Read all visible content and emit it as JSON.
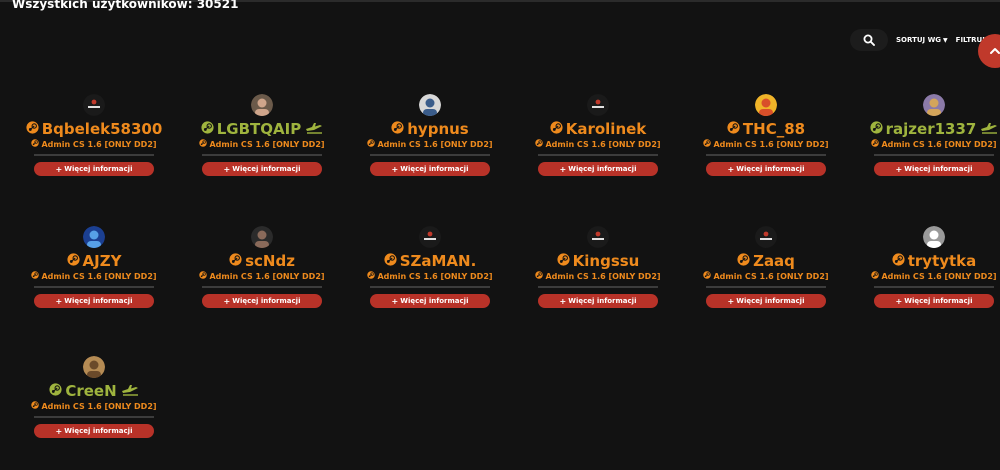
{
  "page": {
    "title": "Wszystkich użytkowników: 30521"
  },
  "toolbar": {
    "sort_label": "SORTUJ WG",
    "filter_label": "FILTRUJ"
  },
  "icons": {
    "search": "search-icon",
    "steam": "steam-icon",
    "plane": "airplane-icon",
    "plus": "plus-icon",
    "scroll_top": "chevron-up-icon"
  },
  "colors": {
    "accent": "#b83228",
    "name_orange": "#ee8a1d",
    "name_green": "#9fb43e",
    "background": "#121212"
  },
  "users": [
    {
      "name": "Bqbelek58300",
      "role": "Admin CS 1.6 [ONLY DD2]",
      "button": "Więcej informacji",
      "name_color": "orange",
      "badge": false,
      "avatar": "logo"
    },
    {
      "name": "LGBTQAIP",
      "role": "Admin CS 1.6 [ONLY DD2]",
      "button": "Więcej informacji",
      "name_color": "green",
      "badge": true,
      "avatar": "photo"
    },
    {
      "name": "hypnus",
      "role": "Admin CS 1.6 [ONLY DD2]",
      "button": "Więcej informacji",
      "name_color": "orange",
      "badge": false,
      "avatar": "photo"
    },
    {
      "name": "Karolinek",
      "role": "Admin CS 1.6 [ONLY DD2]",
      "button": "Więcej informacji",
      "name_color": "orange",
      "badge": false,
      "avatar": "logo"
    },
    {
      "name": "THC_88",
      "role": "Admin CS 1.6 [ONLY DD2]",
      "button": "Więcej informacji",
      "name_color": "orange",
      "badge": false,
      "avatar": "photo"
    },
    {
      "name": "rajzer1337",
      "role": "Admin CS 1.6 [ONLY DD2]",
      "button": "Więcej informacji",
      "name_color": "green",
      "badge": true,
      "avatar": "photo"
    },
    {
      "name": "AJZY",
      "role": "Admin CS 1.6 [ONLY DD2]",
      "button": "Więcej informacji",
      "name_color": "orange",
      "badge": false,
      "avatar": "photo"
    },
    {
      "name": "scNdz",
      "role": "Admin CS 1.6 [ONLY DD2]",
      "button": "Więcej informacji",
      "name_color": "orange",
      "badge": false,
      "avatar": "photo"
    },
    {
      "name": "SZaMAN.",
      "role": "Admin CS 1.6 [ONLY DD2]",
      "button": "Więcej informacji",
      "name_color": "orange",
      "badge": false,
      "avatar": "logo"
    },
    {
      "name": "Kingssu",
      "role": "Admin CS 1.6 [ONLY DD2]",
      "button": "Więcej informacji",
      "name_color": "orange",
      "badge": false,
      "avatar": "logo"
    },
    {
      "name": "Zaaq",
      "role": "Admin CS 1.6 [ONLY DD2]",
      "button": "Więcej informacji",
      "name_color": "orange",
      "badge": false,
      "avatar": "logo"
    },
    {
      "name": "trytytka",
      "role": "Admin CS 1.6 [ONLY DD2]",
      "button": "Więcej informacji",
      "name_color": "orange",
      "badge": false,
      "avatar": "photo"
    },
    {
      "name": "CreeN",
      "role": "Admin CS 1.6 [ONLY DD2]",
      "button": "Więcej informacji",
      "name_color": "green",
      "badge": true,
      "avatar": "photo"
    }
  ]
}
